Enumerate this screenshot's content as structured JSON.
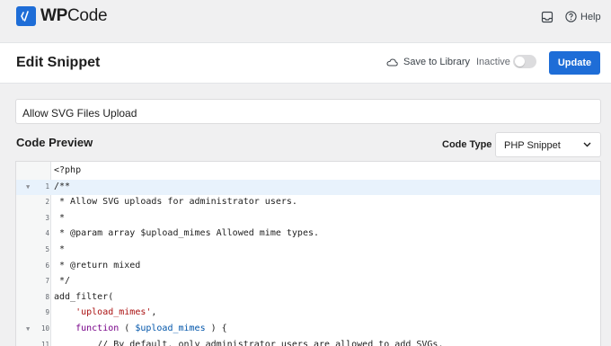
{
  "brand": {
    "name_bold": "WP",
    "name_rest": "Code",
    "accent": "#1e6dd7"
  },
  "topbar": {
    "help_label": "Help"
  },
  "header": {
    "title": "Edit Snippet",
    "save_library_label": "Save to Library",
    "status_label": "Inactive",
    "active": false,
    "update_label": "Update"
  },
  "snippet": {
    "title_value": "Allow SVG Files Upload"
  },
  "code_preview": {
    "title": "Code Preview",
    "code_type_label": "Code Type",
    "code_type_value": "PHP Snippet"
  },
  "editor": {
    "opening_tag": "<?php",
    "lines": [
      {
        "num": "1",
        "fold": true,
        "active": true,
        "kind": "comment",
        "text": "/**"
      },
      {
        "num": "2",
        "fold": false,
        "active": false,
        "kind": "comment",
        "text": " * Allow SVG uploads for administrator users."
      },
      {
        "num": "3",
        "fold": false,
        "active": false,
        "kind": "comment",
        "text": " *"
      },
      {
        "num": "4",
        "fold": false,
        "active": false,
        "kind": "comment",
        "text": " * @param array $upload_mimes Allowed mime types."
      },
      {
        "num": "5",
        "fold": false,
        "active": false,
        "kind": "comment",
        "text": " *"
      },
      {
        "num": "6",
        "fold": false,
        "active": false,
        "kind": "comment",
        "text": " * @return mixed"
      },
      {
        "num": "7",
        "fold": false,
        "active": false,
        "kind": "comment",
        "text": " */"
      },
      {
        "num": "8",
        "fold": false,
        "active": false,
        "kind": "plain",
        "text": "add_filter("
      },
      {
        "num": "9",
        "fold": false,
        "active": false,
        "kind": "string",
        "text": "    'upload_mimes',",
        "indent": "    ",
        "body": "'upload_mimes',",
        "tail": ""
      },
      {
        "num": "10",
        "fold": true,
        "active": false,
        "kind": "func",
        "text": "    function ( $upload_mimes ) {"
      },
      {
        "num": "11",
        "fold": false,
        "active": false,
        "kind": "comment",
        "text": "        // By default, only administrator users are allowed to add SVGs."
      }
    ]
  }
}
